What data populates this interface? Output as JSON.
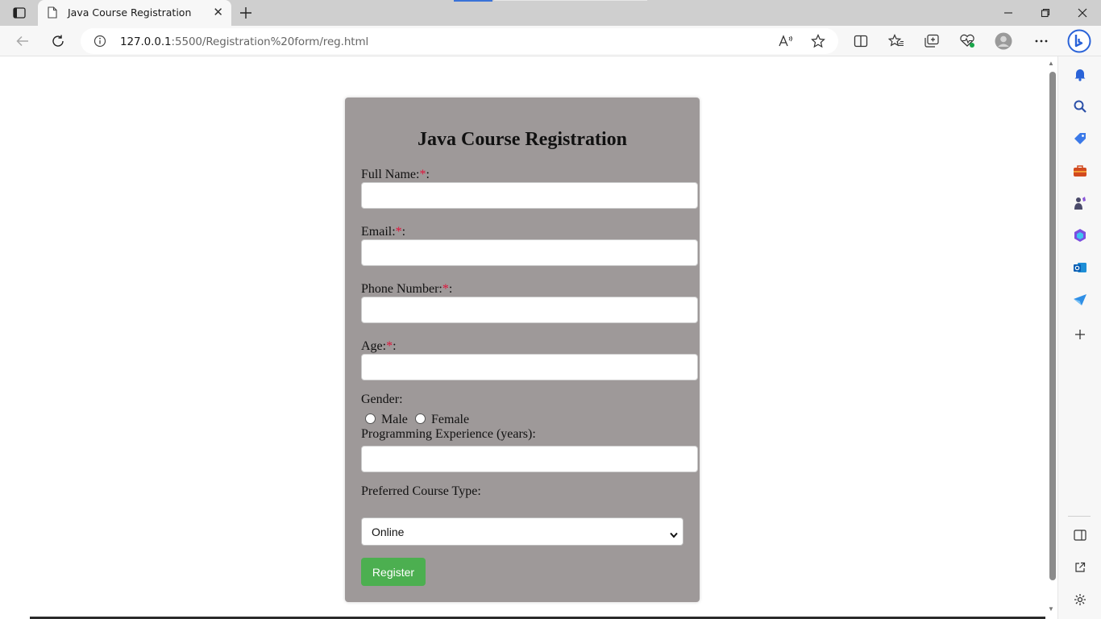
{
  "browser": {
    "tab_title": "Java Course Registration",
    "tab_close": "✕",
    "url_host": "127.0.0.1",
    "url_rest": ":5500/Registration%20form/reg.html"
  },
  "form": {
    "title": "Java Course Registration",
    "required_mark": "*",
    "colon": ":",
    "full_name_label": "Full Name:",
    "email_label": "Email:",
    "phone_label": "Phone Number:",
    "age_label": "Age:",
    "gender_label": "Gender:",
    "gender_options": [
      "Male",
      "Female"
    ],
    "experience_label": "Programming Experience (years):",
    "course_type_label": "Preferred Course Type:",
    "course_type_selected": "Online",
    "register_label": "Register"
  },
  "icons": {
    "tab_actions": "tab-actions-icon",
    "favicon": "page-icon",
    "back": "back-arrow-icon",
    "refresh": "refresh-icon",
    "info": "info-icon",
    "read_aloud": "read-aloud-icon",
    "favorite": "star-icon",
    "split": "split-screen-icon",
    "favorites": "favorites-icon",
    "collections": "collections-icon",
    "performance": "browser-essentials-icon",
    "profile": "profile-avatar-icon",
    "more": "more-icon",
    "bing": "bing-copilot-icon"
  },
  "colors": {
    "card_bg": "#9e9999",
    "required": "#e0123a",
    "register_bg": "#4caf50",
    "tab_strip": "#cfcfcf"
  }
}
